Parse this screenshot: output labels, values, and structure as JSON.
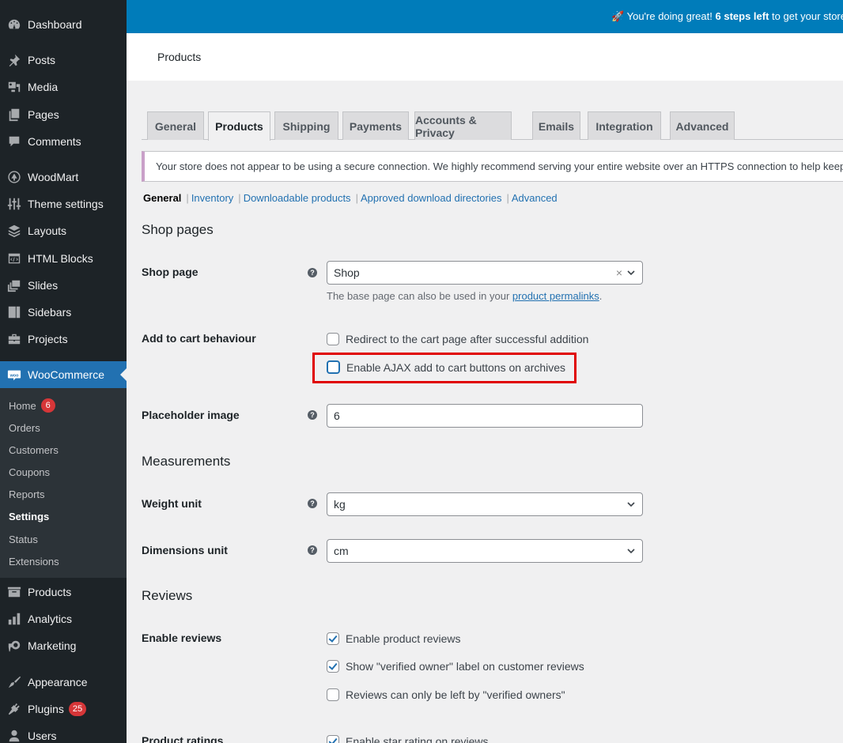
{
  "sidebar": {
    "items": [
      {
        "label": "Dashboard",
        "icon": "dashboard-icon"
      },
      {
        "label": "Posts",
        "icon": "pin-icon"
      },
      {
        "label": "Media",
        "icon": "media-icon"
      },
      {
        "label": "Pages",
        "icon": "pages-icon"
      },
      {
        "label": "Comments",
        "icon": "comment-icon"
      },
      {
        "label": "WoodMart",
        "icon": "woodmart-icon"
      },
      {
        "label": "Theme settings",
        "icon": "sliders-icon"
      },
      {
        "label": "Layouts",
        "icon": "layers-icon"
      },
      {
        "label": "HTML Blocks",
        "icon": "code-block-icon"
      },
      {
        "label": "Slides",
        "icon": "slides-icon"
      },
      {
        "label": "Sidebars",
        "icon": "sidebars-icon"
      },
      {
        "label": "Projects",
        "icon": "briefcase-icon"
      },
      {
        "label": "WooCommerce",
        "icon": "woo-icon",
        "active": true
      },
      {
        "label": "Products",
        "icon": "archive-icon"
      },
      {
        "label": "Analytics",
        "icon": "bar-chart-icon"
      },
      {
        "label": "Marketing",
        "icon": "megaphone-icon"
      },
      {
        "label": "Appearance",
        "icon": "paintbrush-icon"
      },
      {
        "label": "Plugins",
        "icon": "plugin-icon",
        "badge": "25"
      },
      {
        "label": "Users",
        "icon": "user-icon"
      }
    ],
    "woocommerce_submenu": [
      {
        "label": "Home",
        "badge": "6"
      },
      {
        "label": "Orders"
      },
      {
        "label": "Customers"
      },
      {
        "label": "Coupons"
      },
      {
        "label": "Reports"
      },
      {
        "label": "Settings",
        "current": true
      },
      {
        "label": "Status"
      },
      {
        "label": "Extensions"
      }
    ]
  },
  "banner": {
    "emoji": "🚀",
    "text_before": "You're doing great!",
    "text_bold": "6 steps left",
    "text_after": "to get your store"
  },
  "header": {
    "title": "Products"
  },
  "tabs": [
    {
      "label": "General"
    },
    {
      "label": "Products",
      "active": true
    },
    {
      "label": "Shipping"
    },
    {
      "label": "Payments"
    },
    {
      "label": "Accounts & Privacy"
    },
    {
      "label": "Emails"
    },
    {
      "label": "Integration"
    },
    {
      "label": "Advanced"
    }
  ],
  "notice": {
    "text": "Your store does not appear to be using a secure connection. We highly recommend serving your entire website over an HTTPS connection to help keep"
  },
  "subnav": {
    "current": "General",
    "links": [
      "Inventory",
      "Downloadable products",
      "Approved download directories",
      "Advanced"
    ]
  },
  "sections": {
    "shop_pages": "Shop pages",
    "measurements": "Measurements",
    "reviews": "Reviews"
  },
  "fields": {
    "shop_page": {
      "label": "Shop page",
      "value": "Shop",
      "desc_before": "The base page can also be used in your",
      "desc_link": "product permalinks",
      "desc_after": "."
    },
    "add_to_cart": {
      "label": "Add to cart behaviour",
      "options": [
        {
          "label": "Redirect to the cart page after successful addition",
          "checked": false
        },
        {
          "label": "Enable AJAX add to cart buttons on archives",
          "checked": false
        }
      ]
    },
    "placeholder_image": {
      "label": "Placeholder image",
      "value": "6"
    },
    "weight_unit": {
      "label": "Weight unit",
      "value": "kg"
    },
    "dimensions_unit": {
      "label": "Dimensions unit",
      "value": "cm"
    },
    "enable_reviews": {
      "label": "Enable reviews",
      "options": [
        {
          "label": "Enable product reviews",
          "checked": true
        },
        {
          "label": "Show \"verified owner\" label on customer reviews",
          "checked": true
        },
        {
          "label": "Reviews can only be left by \"verified owners\"",
          "checked": false
        }
      ]
    },
    "product_ratings": {
      "label": "Product ratings",
      "options": [
        {
          "label": "Enable star rating on reviews",
          "checked": true
        }
      ]
    }
  },
  "help_glyph": "?",
  "clear_glyph": "×",
  "colors": {
    "sidebar_bg": "#1d2327",
    "submenu_bg": "#2c3338",
    "accent": "#2271b1",
    "banner_bg": "#007cba",
    "badge": "#d63638",
    "highlight": "#e00000"
  }
}
